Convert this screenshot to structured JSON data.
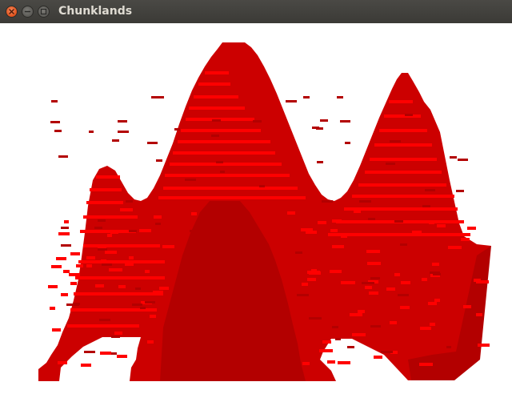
{
  "window": {
    "title": "Chunklands",
    "buttons": [
      {
        "name": "close-button",
        "icon": "close-icon"
      },
      {
        "name": "minimize-button",
        "icon": "minimize-icon"
      },
      {
        "name": "maximize-button",
        "icon": "maximize-icon"
      }
    ]
  },
  "scene": {
    "type": "voxel-terrain",
    "block_color": "#cc0000",
    "block_dark": "#b30000",
    "block_light": "#ff0000",
    "background": "#ffffff"
  }
}
